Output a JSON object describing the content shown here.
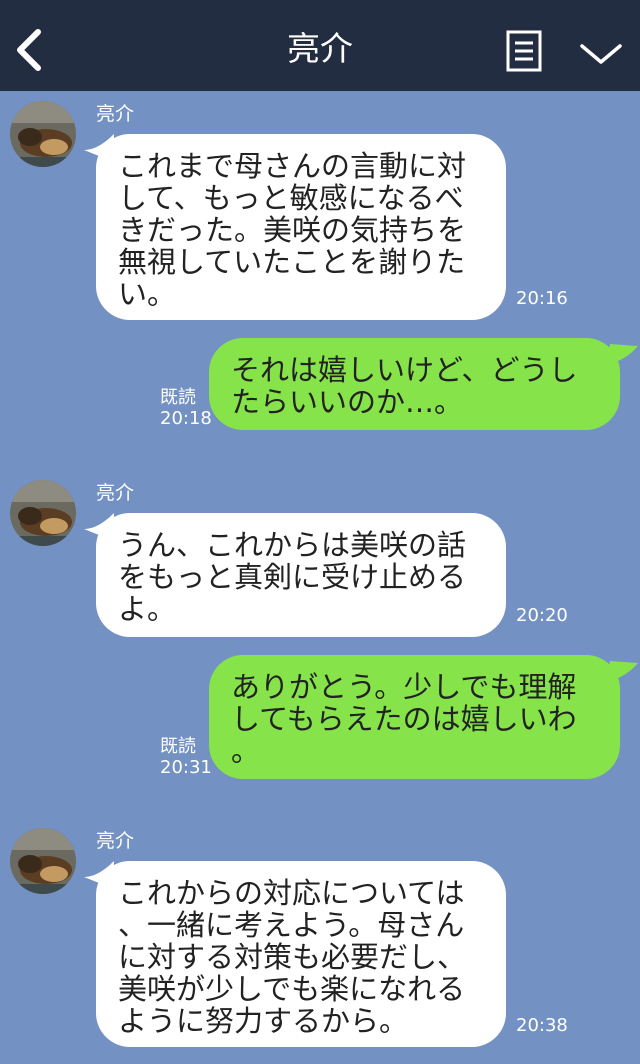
{
  "header": {
    "title": "亮介",
    "back_icon": "chevron-left-icon",
    "memo_icon": "note-icon",
    "menu_icon": "chevron-down-icon"
  },
  "colors": {
    "background": "#7391c2",
    "header": "#232d42",
    "outgoing_bubble": "#86e34a",
    "incoming_bubble": "#ffffff"
  },
  "messages": [
    {
      "direction": "in",
      "sender": "亮介",
      "lines": [
        "これまで母さんの言動に対",
        "して、もっと敏感になるべ",
        "きだった。美咲の気持ちを",
        "無視していたことを謝りた",
        "い。"
      ],
      "time": "20:16"
    },
    {
      "direction": "out",
      "read_label": "既読",
      "lines": [
        "それは嬉しいけど、どうし",
        "たらいいのか…。"
      ],
      "time": "20:18"
    },
    {
      "direction": "in",
      "sender": "亮介",
      "lines": [
        "うん、これからは美咲の話",
        "をもっと真剣に受け止める",
        "よ。"
      ],
      "time": "20:20"
    },
    {
      "direction": "out",
      "read_label": "既読",
      "lines": [
        "ありがとう。少しでも理解",
        "してもらえたのは嬉しいわ",
        "。"
      ],
      "time": "20:31"
    },
    {
      "direction": "in",
      "sender": "亮介",
      "lines": [
        "これからの対応については",
        "、一緒に考えよう。母さん",
        "に対する対策も必要だし、",
        "美咲が少しでも楽になれる",
        "ように努力するから。"
      ],
      "time": "20:38"
    }
  ]
}
